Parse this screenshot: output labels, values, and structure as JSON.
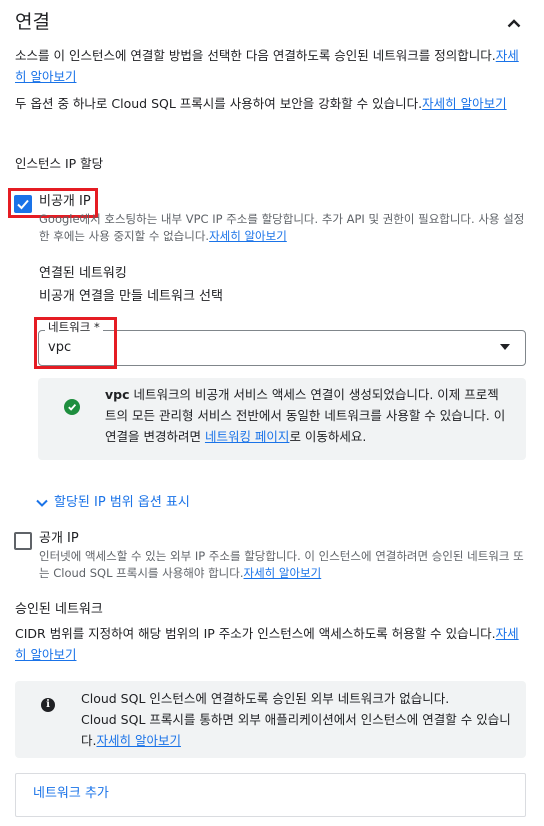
{
  "header": {
    "title": "연결"
  },
  "intro": {
    "line1": "소스를 이 인스턴스에 연결할 방법을 선택한 다음 연결하도록 승인된 네트워크를 정의합니다.",
    "line1_link": "자세히 알아보기",
    "line2": "두 옵션 중 하나로 Cloud SQL 프록시를 사용하여 보안을 강화할 수 있습니다.",
    "line2_link": "자세히 알아보기"
  },
  "ip_assignment": {
    "section_label": "인스턴스 IP 할당",
    "private_ip": {
      "label": "비공개 IP",
      "checked": true,
      "description": "Google에서 호스팅하는 내부 VPC IP 주소를 할당합니다. 추가 API 및 권한이 필요합니다. 사용 설정한 후에는 사용 중지할 수 없습니다.",
      "link": "자세히 알아보기"
    },
    "connected_network": {
      "title": "연결된 네트워킹",
      "subtitle": "비공개 연결을 만들 네트워크 선택",
      "field_label": "네트워크 *",
      "value": "vpc"
    },
    "vpc_notice": {
      "bold": "vpc",
      "text": " 네트워크의 비공개 서비스 액세스 연결이 생성되었습니다. 이제 프로젝트의 모든 관리형 서비스 전반에서 동일한 네트워크를 사용할 수 있습니다. 이 연결을 변경하려면 ",
      "link": "네트워킹 페이지",
      "suffix": "로 이동하세요."
    },
    "ip_range_toggle": "할당된 IP 범위 옵션 표시",
    "public_ip": {
      "label": "공개 IP",
      "checked": false,
      "description": "인터넷에 액세스할 수 있는 외부 IP 주소를 할당합니다. 이 인스턴스에 연결하려면 승인된 네트워크 또는 Cloud SQL 프록시를 사용해야 합니다.",
      "link": "자세히 알아보기"
    }
  },
  "authorized_networks": {
    "title": "승인된 네트워크",
    "description": "CIDR 범위를 지정하여 해당 범위의 IP 주소가 인스턴스에 액세스하도록 허용할 수 있습니다.",
    "link": "자세히 알아보기",
    "notice_line1": "Cloud SQL 인스턴스에 연결하도록 승인된 외부 네트워크가 없습니다.",
    "notice_line2": "Cloud SQL 프록시를 통하면 외부 애플리케이션에서 인스턴스에 연결할 수 있습니다.",
    "notice_link": "자세히 알아보기",
    "add_button": "네트워크 추가"
  },
  "colors": {
    "accent": "#1a73e8",
    "highlight": "#e51c23",
    "success": "#1e8e3e",
    "panel": "#f1f3f4"
  },
  "icons": {
    "collapse": "chevron-up-icon",
    "checkbox_checked": "checkmark-icon",
    "select": "caret-down-icon",
    "success": "check-circle-icon",
    "toggle": "chevron-down-icon",
    "info": "info-icon"
  }
}
